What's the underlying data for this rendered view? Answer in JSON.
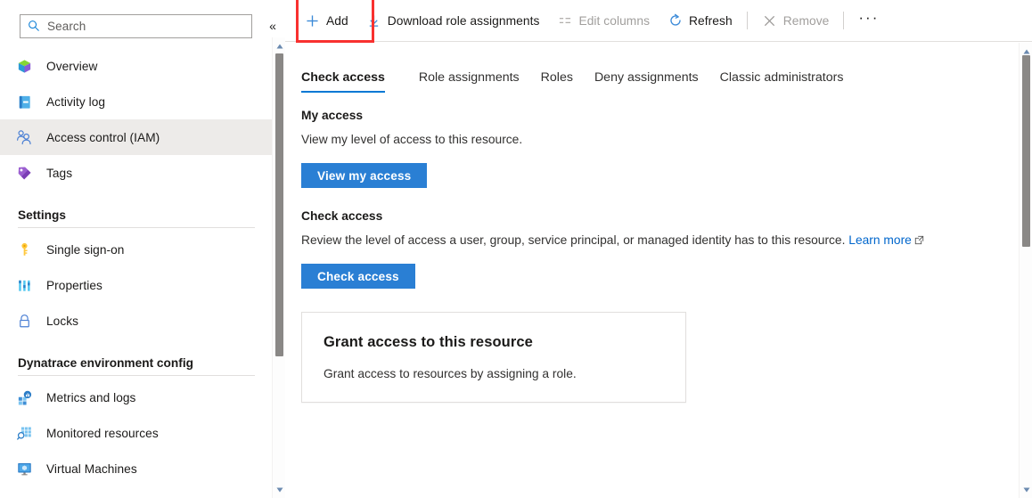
{
  "sidebar": {
    "search": {
      "placeholder": "Search",
      "icon": "search-icon"
    },
    "collapse_label": "«",
    "items": [
      {
        "label": "Overview",
        "icon": "overview-cube-icon",
        "selected": false
      },
      {
        "label": "Activity log",
        "icon": "activity-log-icon",
        "selected": false
      },
      {
        "label": "Access control (IAM)",
        "icon": "access-control-people-icon",
        "selected": true
      },
      {
        "label": "Tags",
        "icon": "tag-icon",
        "selected": false
      }
    ],
    "groups": [
      {
        "title": "Settings",
        "items": [
          {
            "label": "Single sign-on",
            "icon": "key-icon"
          },
          {
            "label": "Properties",
            "icon": "properties-bars-icon"
          },
          {
            "label": "Locks",
            "icon": "lock-icon"
          }
        ]
      },
      {
        "title": "Dynatrace environment config",
        "items": [
          {
            "label": "Metrics and logs",
            "icon": "metrics-and-logs-icon"
          },
          {
            "label": "Monitored resources",
            "icon": "monitored-resources-icon"
          },
          {
            "label": "Virtual Machines",
            "icon": "virtual-machines-icon"
          }
        ]
      }
    ]
  },
  "toolbar": {
    "add_label": "Add",
    "download_label": "Download role assignments",
    "edit_columns_label": "Edit columns",
    "refresh_label": "Refresh",
    "remove_label": "Remove",
    "more_label": "···",
    "highlight_color": "#f8312f"
  },
  "tabs": [
    {
      "label": "Check access",
      "active": true
    },
    {
      "label": "Role assignments",
      "active": false
    },
    {
      "label": "Roles",
      "active": false
    },
    {
      "label": "Deny assignments",
      "active": false
    },
    {
      "label": "Classic administrators",
      "active": false
    }
  ],
  "main": {
    "my_access": {
      "title": "My access",
      "description": "View my level of access to this resource.",
      "button_label": "View my access"
    },
    "check_access": {
      "title": "Check access",
      "description": "Review the level of access a user, group, service principal, or managed identity has to this resource. ",
      "link_text": "Learn more",
      "button_label": "Check access"
    },
    "grant_card": {
      "title": "Grant access to this resource",
      "description": "Grant access to resources by assigning a role."
    }
  },
  "colors": {
    "accent": "#0078d4",
    "button": "#2a7fd4",
    "link": "#0066cc",
    "selected_bg": "#edebe9",
    "highlight": "#f8312f"
  }
}
